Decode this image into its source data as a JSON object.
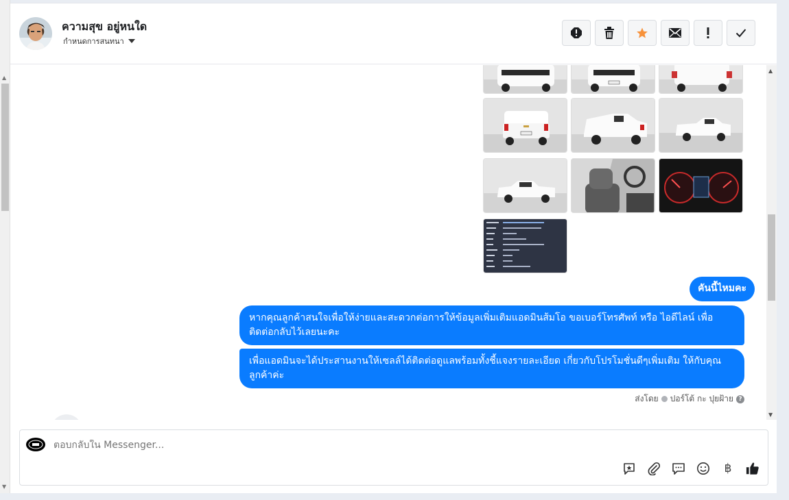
{
  "conversation": {
    "name": "ความสุข อยู่หนใด",
    "subtitle": "กำหนดการสนทนา"
  },
  "header_actions": [
    {
      "icon": "spam-icon"
    },
    {
      "icon": "trash-icon"
    },
    {
      "icon": "star-icon",
      "color": "#f7923b"
    },
    {
      "icon": "mail-icon"
    },
    {
      "icon": "important-icon"
    },
    {
      "icon": "check-icon"
    }
  ],
  "messages": [
    {
      "text": "คันนี้ไหมคะ"
    },
    {
      "text": "หากคุณลูกค้าสนใจเพื่อให้ง่ายและสะดวกต่อการให้ข้อมูลเพิ่มเติมแอดมินส้มโอ ขอเบอร์โทรศัพท์ หรือ ไอดีไลน์ เพื่อติดต่อกลับไว้เลยนะคะ"
    },
    {
      "text": "เพื่อแอดมินจะได้ประสานงานให้เซลล์ได้ติดต่อดูแลพร้อมทั้งชี้แจงรายละเอียด เกี่ยวกับโปรโมชั่นดีๆเพิ่มเติม ให้กับคุณลูกค้าค่ะ"
    }
  ],
  "sent_by": {
    "label": "ส่งโดย",
    "agent": "ปอร์โต้ กะ ปุยฝ้าย"
  },
  "composer": {
    "placeholder": "ตอบกลับใน Messenger...",
    "tools": [
      "saved-reply-icon",
      "attachment-icon",
      "comment-icon",
      "emoji-icon",
      "baht-icon",
      "thumbs-up-icon"
    ]
  },
  "colors": {
    "bubble": "#0a7cff",
    "accent_star": "#f7923b"
  }
}
